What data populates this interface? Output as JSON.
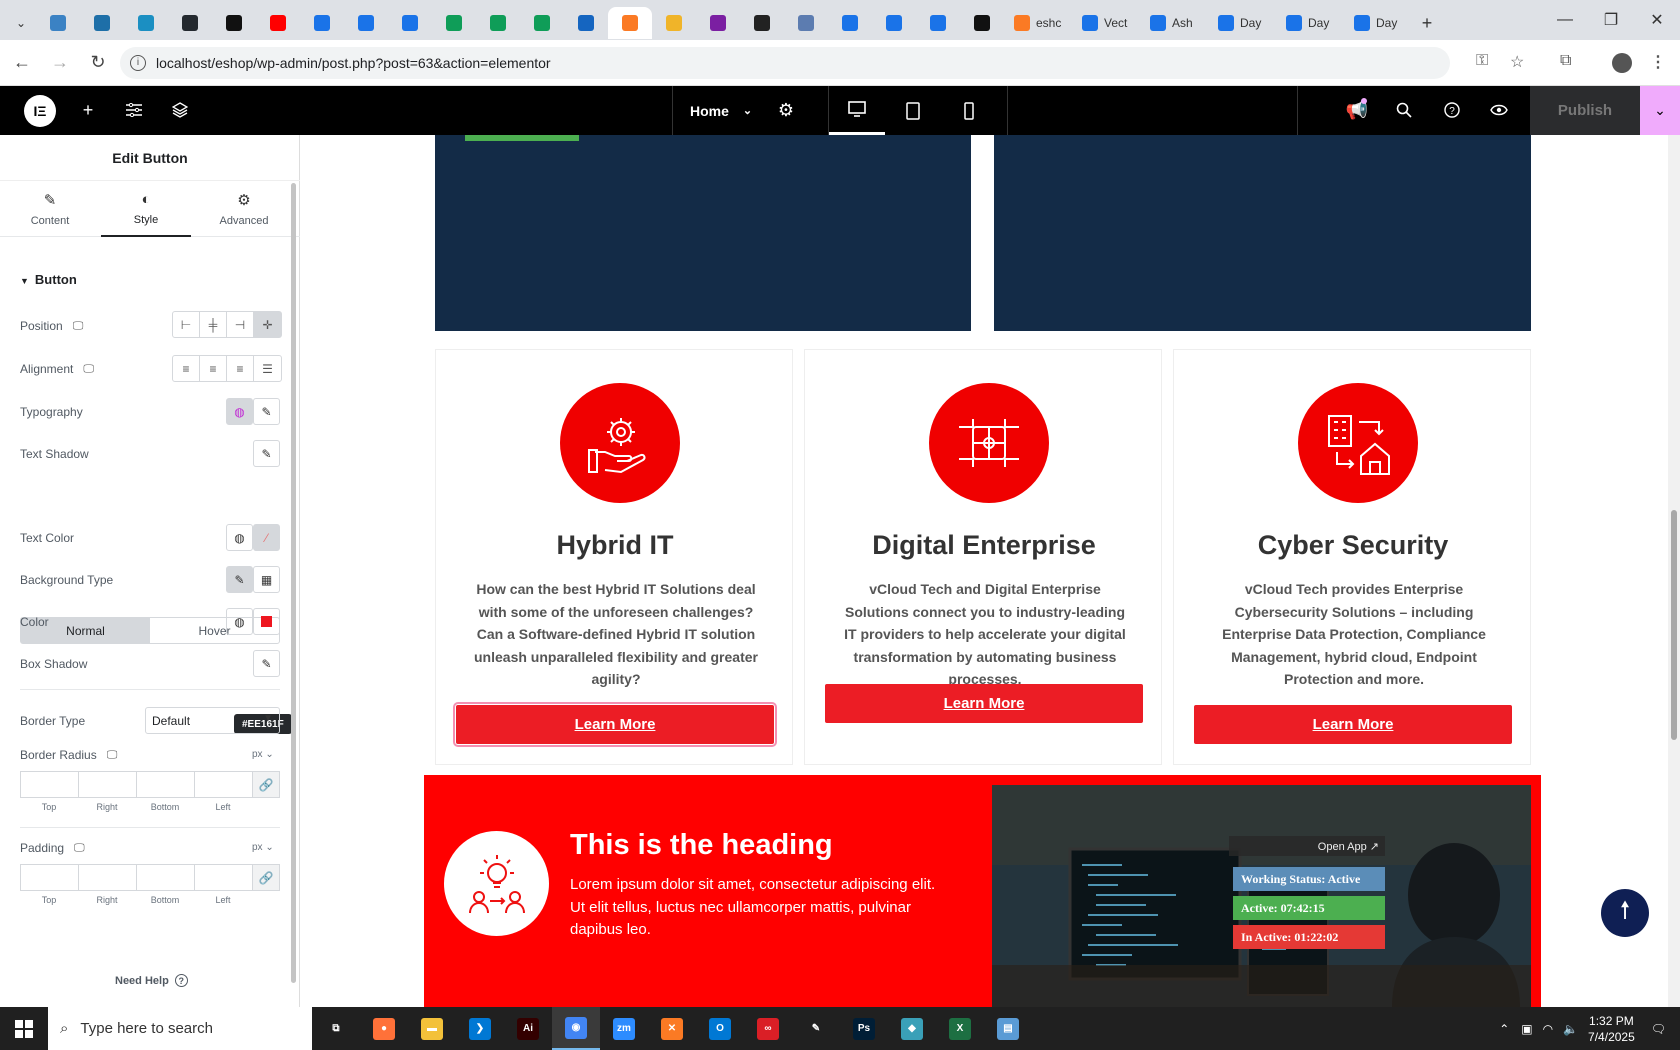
{
  "browser": {
    "tabs": [
      {
        "icon": "wordpress-icon",
        "color": "#3b82c4"
      },
      {
        "icon": "wordpress-icon",
        "color": "#1e6fa8"
      },
      {
        "icon": "app-icon",
        "color": "#1b8fc2"
      },
      {
        "icon": "github-icon",
        "color": "#24292f"
      },
      {
        "icon": "bolt-icon",
        "color": "#111111"
      },
      {
        "icon": "youtube-icon",
        "color": "#ff0000"
      },
      {
        "icon": "docs-icon",
        "color": "#1a73e8"
      },
      {
        "icon": "docs-icon",
        "color": "#1a73e8"
      },
      {
        "icon": "docs-icon",
        "color": "#1a73e8"
      },
      {
        "icon": "sheets-icon",
        "color": "#0f9d58"
      },
      {
        "icon": "sheets-icon",
        "color": "#0f9d58"
      },
      {
        "icon": "sheets-icon",
        "color": "#0f9d58"
      },
      {
        "icon": "app-icon",
        "color": "#1565c0"
      },
      {
        "icon": "xampp-icon",
        "color": "#fb7a24",
        "active": true
      },
      {
        "icon": "crown-icon",
        "color": "#f0b429"
      },
      {
        "icon": "brackets-icon",
        "color": "#7b1fa2"
      },
      {
        "icon": "app-icon",
        "color": "#222222"
      },
      {
        "icon": "app-icon",
        "color": "#5c7cb0"
      },
      {
        "icon": "docs-icon",
        "color": "#1a73e8"
      },
      {
        "icon": "docs-icon",
        "color": "#1a73e8"
      },
      {
        "icon": "docs-icon",
        "color": "#1a73e8"
      },
      {
        "icon": "medium-icon",
        "color": "#111111"
      }
    ],
    "labeled_tabs": [
      {
        "label": "eshc",
        "color": "#fb7a24"
      },
      {
        "label": "Vect",
        "color": "#1a73e8"
      },
      {
        "label": "Ash",
        "color": "#1a73e8"
      },
      {
        "label": "Day",
        "color": "#1a73e8"
      },
      {
        "label": "Day",
        "color": "#1a73e8"
      },
      {
        "label": "Day",
        "color": "#1a73e8"
      }
    ],
    "new_tab": "+",
    "url": "localhost/eshop/wp-admin/post.php?post=63&action=elementor"
  },
  "elementor": {
    "page_name": "Home",
    "publish_label": "Publish",
    "panel": {
      "title": "Edit Button",
      "tabs": [
        {
          "label": "Content",
          "icon": "pencil-icon"
        },
        {
          "label": "Style",
          "icon": "contrast-icon",
          "active": true
        },
        {
          "label": "Advanced",
          "icon": "gear-icon"
        }
      ],
      "section": "Button",
      "position_label": "Position",
      "alignment_label": "Alignment",
      "typography_label": "Typography",
      "text_shadow_label": "Text Shadow",
      "state_normal": "Normal",
      "state_hover": "Hover",
      "text_color_label": "Text Color",
      "bg_type_label": "Background Type",
      "color_label": "Color",
      "color_value": "#EE161F",
      "box_shadow_label": "Box Shadow",
      "border_type_label": "Border Type",
      "border_type_value": "Default",
      "border_radius_label": "Border Radius",
      "padding_label": "Padding",
      "unit": "px",
      "dim_top": "Top",
      "dim_right": "Right",
      "dim_bottom": "Bottom",
      "dim_left": "Left",
      "need_help": "Need Help"
    }
  },
  "page": {
    "cards": [
      {
        "title": "Hybrid IT",
        "text": "How can the best Hybrid IT Solutions deal with some of the unforeseen challenges? Can a Software-defined Hybrid IT solution unleash unparalleled flexibility and greater agility?",
        "button": "Learn More",
        "icon": "gear-hand-icon"
      },
      {
        "title": "Digital Enterprise",
        "text": "vCloud Tech and Digital Enterprise Solutions connect you to industry-leading IT providers to help accelerate your digital transformation by automating business processes.",
        "button": "Learn More",
        "icon": "puzzle-hands-icon"
      },
      {
        "title": "Cyber Security",
        "text": "vCloud Tech provides Enterprise Cybersecurity Solutions – including Enterprise Data Protection, Compliance Management, hybrid cloud, Endpoint Protection and more.",
        "button": "Learn More",
        "icon": "buildings-home-icon"
      }
    ],
    "band": {
      "heading": "This is the heading",
      "text": "Lorem ipsum dolor sit amet, consectetur adipiscing elit. Ut elit tellus, luctus nec ullamcorper mattis, pulvinar dapibus leo.",
      "icon": "idea-people-icon"
    }
  },
  "tracker": {
    "open_app": "Open App ↗",
    "status": "Working Status: Active",
    "active": "Active: 07:42:15",
    "inactive": "In Active: 01:22:02"
  },
  "taskbar": {
    "search_placeholder": "Type here to search",
    "time": "1:32 PM",
    "date": "7/4/2025",
    "apps": [
      {
        "name": "task-view-icon",
        "color": "#202020",
        "glyph": "⧉"
      },
      {
        "name": "firefox-icon",
        "color": "#ff7139",
        "glyph": "●"
      },
      {
        "name": "file-explorer-icon",
        "color": "#f3c13a",
        "glyph": "▬"
      },
      {
        "name": "vscode-icon",
        "color": "#0078d4",
        "glyph": "❯"
      },
      {
        "name": "illustrator-icon",
        "color": "#330000",
        "glyph": "Ai"
      },
      {
        "name": "chrome-icon",
        "color": "#4285f4",
        "glyph": "◉",
        "active": true
      },
      {
        "name": "zoom-icon",
        "color": "#2d8cff",
        "glyph": "zm"
      },
      {
        "name": "xampp-icon",
        "color": "#fb7a24",
        "glyph": "✕"
      },
      {
        "name": "outlook-icon",
        "color": "#0078d4",
        "glyph": "O"
      },
      {
        "name": "creative-cloud-icon",
        "color": "#da1f26",
        "glyph": "∞"
      },
      {
        "name": "pen-tool-icon",
        "color": "#202020",
        "glyph": "✎"
      },
      {
        "name": "photoshop-icon",
        "color": "#001e36",
        "glyph": "Ps"
      },
      {
        "name": "app-icon",
        "color": "#3aa0b8",
        "glyph": "◆"
      },
      {
        "name": "excel-icon",
        "color": "#1d6f42",
        "glyph": "X"
      },
      {
        "name": "notepad-icon",
        "color": "#5a9bd5",
        "glyph": "▤"
      }
    ]
  }
}
